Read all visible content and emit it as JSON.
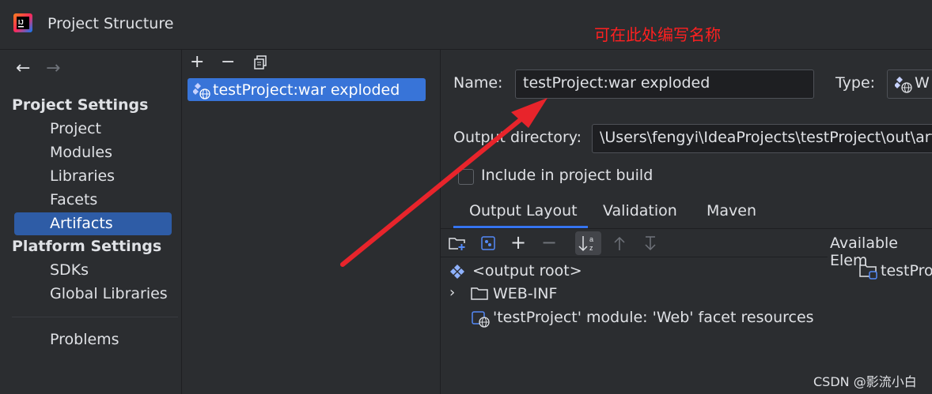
{
  "window": {
    "title": "Project Structure"
  },
  "annotation": {
    "text": "可在此处编写名称"
  },
  "sidebar": {
    "project_settings_title": "Project Settings",
    "project_items": [
      "Project",
      "Modules",
      "Libraries",
      "Facets",
      "Artifacts"
    ],
    "selected_item": "Artifacts",
    "platform_settings_title": "Platform Settings",
    "platform_items": [
      "SDKs",
      "Global Libraries"
    ],
    "other_items": [
      "Problems"
    ]
  },
  "artifacts_list": {
    "items": [
      "testProject:war exploded"
    ]
  },
  "details": {
    "name_label": "Name:",
    "name_value": "testProject:war exploded",
    "type_label": "Type:",
    "type_value": "W",
    "output_dir_label": "Output directory:",
    "output_dir_value": "\\Users\\fengyi\\IdeaProjects\\testProject\\out\\arti",
    "include_build_label": "Include in project build",
    "include_build_checked": false,
    "tabs": [
      "Output Layout",
      "Validation",
      "Maven"
    ],
    "active_tab": "Output Layout",
    "available_elements_label": "Available Elem",
    "available_elements": [
      "testPro"
    ],
    "tree": [
      {
        "label": "<output root>",
        "icon": "output-root-icon"
      },
      {
        "label": "WEB-INF",
        "icon": "folder-icon",
        "expandable": true
      },
      {
        "label": "'testProject' module: 'Web' facet resources",
        "icon": "web-facet-icon"
      }
    ]
  },
  "watermark": "CSDN @影流小白",
  "colors": {
    "selection": "#2e5ca6",
    "accent": "#3574f0",
    "annotation": "#ff2020"
  }
}
